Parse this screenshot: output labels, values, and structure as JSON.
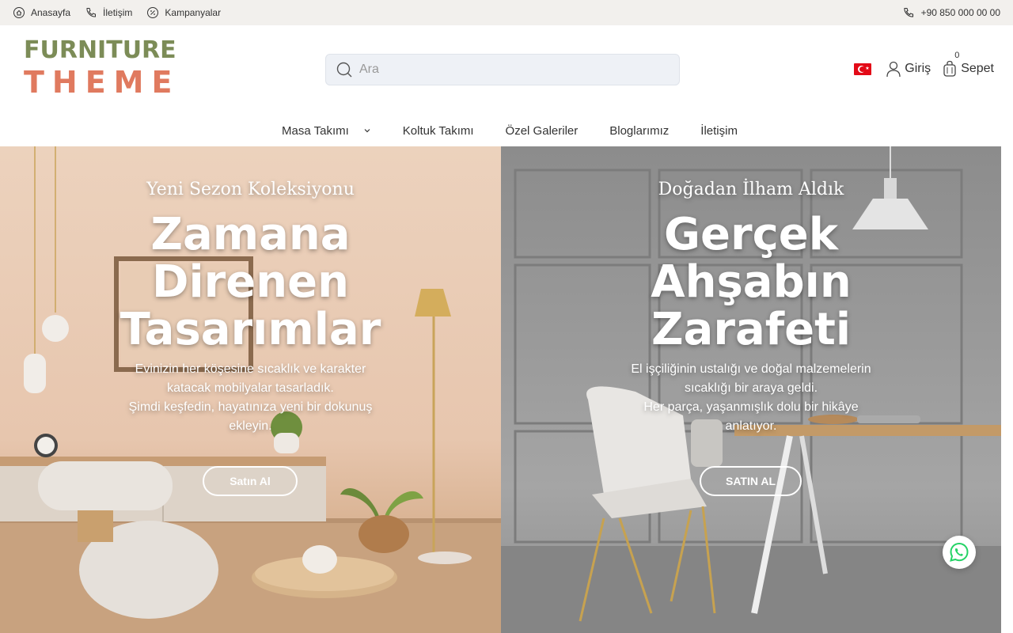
{
  "topbar": {
    "links": [
      {
        "label": "Anasayfa",
        "icon": "home-icon"
      },
      {
        "label": "İletişim",
        "icon": "phone-icon"
      },
      {
        "label": "Kampanyalar",
        "icon": "percent-icon"
      }
    ],
    "phone": "+90 850 000 00 00"
  },
  "logo": {
    "line1": "FURNITURE",
    "line2": "THEME"
  },
  "search": {
    "placeholder": "Ara"
  },
  "header": {
    "login": "Giriş",
    "cart": "Sepet",
    "cart_count": "0"
  },
  "nav": {
    "items": [
      "Masa Takımı",
      "Koltuk Takımı",
      "Özel Galeriler",
      "Bloglarımız",
      "İletişim"
    ]
  },
  "hero": {
    "left": {
      "subtitle": "Yeni Sezon Koleksiyonu",
      "title_lines": [
        "Zamana",
        "Direnen",
        "Tasarımlar"
      ],
      "desc_lines": [
        "Evinizin her köşesine sıcaklık ve karakter",
        "katacak mobilyalar tasarladık.",
        "Şimdi keşfedin, hayatınıza yeni bir dokunuş",
        "ekleyin."
      ],
      "cta": "Satın Al"
    },
    "right": {
      "subtitle": "Doğadan İlham Aldık",
      "title_lines": [
        "Gerçek",
        "Ahşabın",
        "Zarafeti"
      ],
      "desc_lines": [
        "El işçiliğinin ustalığı ve doğal malzemelerin",
        "sıcaklığı bir araya geldi.",
        "Her parça, yaşanmışlık dolu bir hikâye",
        "anlatıyor."
      ],
      "cta": "SATIN AL"
    }
  },
  "colors": {
    "logo_green": "#7c8c57",
    "logo_orange": "#e07a5f",
    "whatsapp": "#25d366"
  }
}
